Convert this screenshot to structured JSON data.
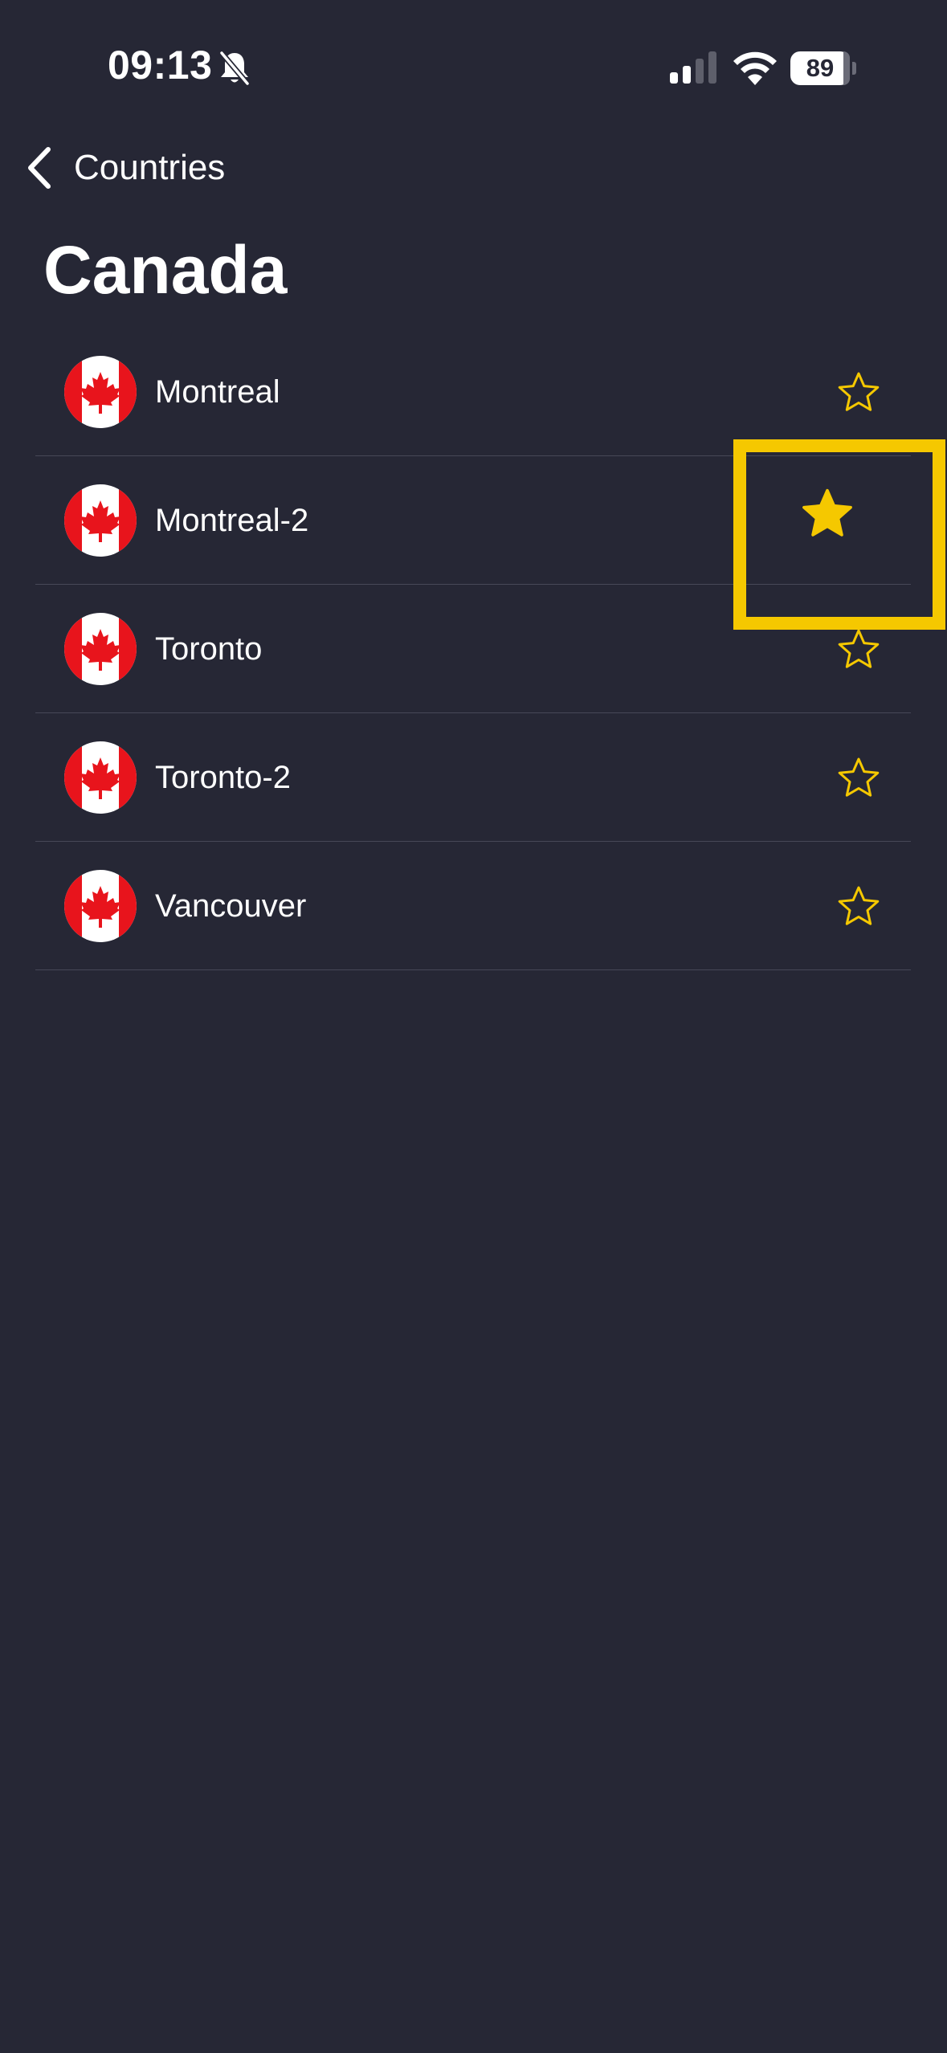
{
  "status_bar": {
    "time": "09:13",
    "battery": "89",
    "icons": [
      "bell-slash-icon",
      "cellular-signal-icon",
      "wifi-icon",
      "battery-icon"
    ]
  },
  "nav": {
    "back_label": "Countries",
    "back_icon": "chevron-left-icon"
  },
  "title": "Canada",
  "cities": [
    {
      "name": "Montreal",
      "favorite": false
    },
    {
      "name": "Montreal-2",
      "favorite": true
    },
    {
      "name": "Toronto",
      "favorite": false
    },
    {
      "name": "Toronto-2",
      "favorite": false
    },
    {
      "name": "Vancouver",
      "favorite": false
    }
  ],
  "colors": {
    "background": "#262735",
    "star": "#f5c800",
    "highlight": "#f5c800",
    "flag_red": "#e8141c",
    "divider": "#474857"
  }
}
